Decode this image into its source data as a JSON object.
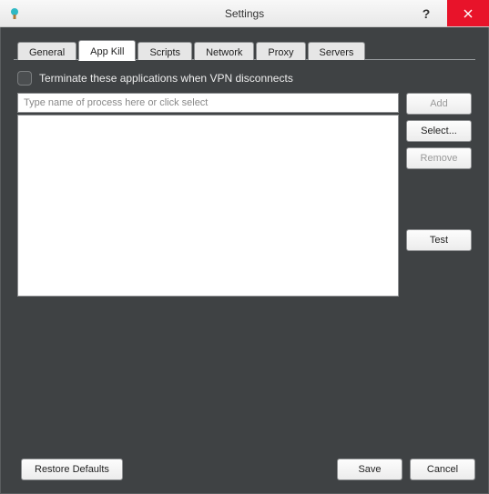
{
  "window": {
    "title": "Settings",
    "help_glyph": "?",
    "accent_close": "#e8132a"
  },
  "tabs": {
    "general": "General",
    "appkill": "App Kill",
    "scripts": "Scripts",
    "network": "Network",
    "proxy": "Proxy",
    "servers": "Servers"
  },
  "appkill": {
    "checkbox_label": "Terminate these applications when VPN disconnects",
    "input_placeholder": "Type name of process here or click select",
    "buttons": {
      "add": "Add",
      "select": "Select...",
      "remove": "Remove",
      "test": "Test"
    },
    "process_list": []
  },
  "footer": {
    "restore": "Restore Defaults",
    "save": "Save",
    "cancel": "Cancel"
  }
}
